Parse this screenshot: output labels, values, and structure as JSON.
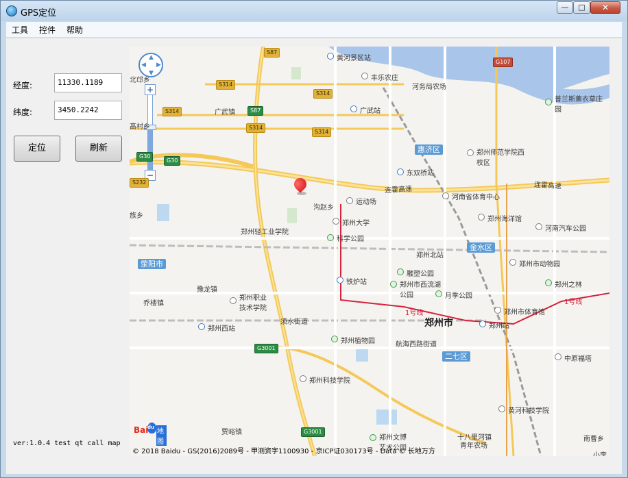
{
  "window": {
    "title": "GPS定位",
    "minimize_glyph": "—",
    "maximize_glyph": "□",
    "close_glyph": "✕"
  },
  "menu": {
    "items": [
      "工具",
      "控件",
      "帮助"
    ]
  },
  "form": {
    "longitude_label": "经度:",
    "longitude_value": "11330.1189",
    "latitude_label": "纬度:",
    "latitude_value": "3450.2242",
    "locate_button": "定位",
    "refresh_button": "刷新"
  },
  "version": "ver:1.0.4 test qt call map",
  "map": {
    "copyright": "© 2018 Baidu - GS(2016)2089号 - 甲测资字1100930 - 京ICP证030173号 - Data © 长地万方",
    "logo": {
      "bai": "Bai",
      "du": "du",
      "ditu": "地图"
    },
    "zoom_in": "+",
    "zoom_out": "−",
    "districts": [
      "荥阳市",
      "惠济区",
      "金水区",
      "二七区"
    ],
    "city_label": "郑州市",
    "road_labels": [
      "连霍高速",
      "连霍高速",
      "1号线",
      "1号线"
    ],
    "shields": [
      "S87",
      "S314",
      "S314",
      "S314",
      "S87",
      "S314",
      "S314",
      "G30",
      "G30",
      "S232",
      "G107",
      "G3001",
      "G3001"
    ],
    "places": [
      "黄河景区站",
      "丰乐农庄",
      "河务局农场",
      "广武镇",
      "广武站",
      "普兰斯薰衣草庄园",
      "郑州师范学院西校区",
      "东双桥站",
      "沟赵乡",
      "运动场",
      "河南省体育中心",
      "郑州大学",
      "郑州海洋馆",
      "河南汽车公园",
      "郑州轻工业学院",
      "科学公园",
      "郑州北站",
      "郑州市动物园",
      "雕塑公园",
      "郑州市西流湖公园",
      "铁炉站",
      "郑州之林",
      "豫龙镇",
      "郑州职业技术学院",
      "乔楼镇",
      "月季公园",
      "郑州市体育馆",
      "郑州站",
      "郑州西站",
      "须水街道",
      "郑州植物园",
      "航海西路街道",
      "中原福塔",
      "郑州科技学院",
      "黄河科技学院",
      "贾峪镇",
      "郑州文博艺术公园",
      "十八里河镇",
      "青年农场",
      "南曹乡",
      "北邙乡",
      "高村乡",
      "族乡",
      "广武镇",
      "小李"
    ]
  }
}
